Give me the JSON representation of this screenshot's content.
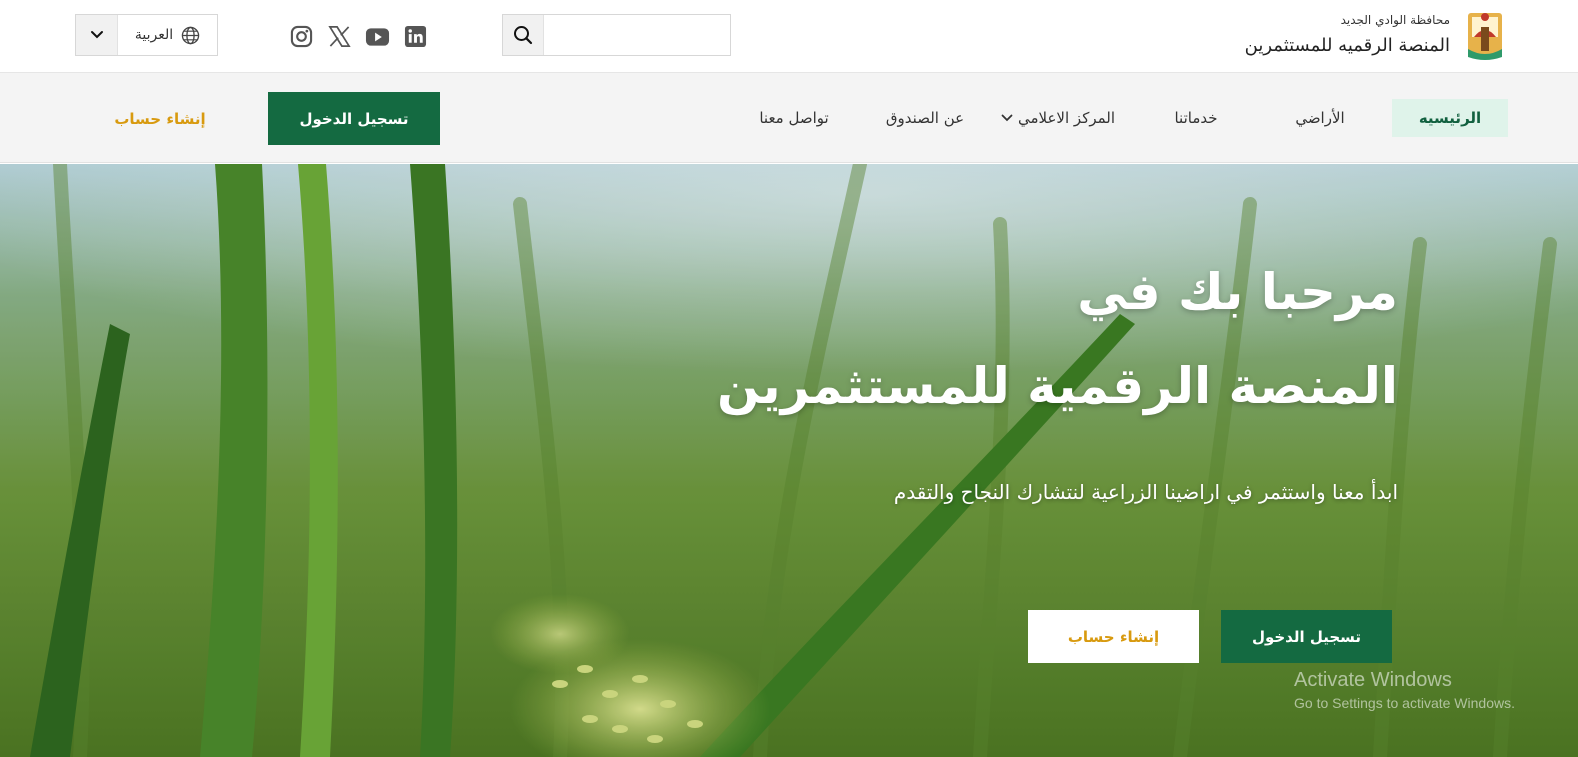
{
  "header": {
    "governorate": "محافظة الوادي الجديد",
    "platform_name": "المنصة الرقميه للمستثمرين",
    "search": {
      "placeholder": "",
      "value": ""
    },
    "social_icons": [
      "instagram-icon",
      "x-icon",
      "youtube-icon",
      "linkedin-icon"
    ],
    "language": {
      "label": "العربية",
      "icon": "globe-icon"
    }
  },
  "nav": {
    "items": [
      {
        "label": "الرئيسيه",
        "active": true
      },
      {
        "label": "الأراضي"
      },
      {
        "label": "خدماتنا"
      },
      {
        "label": "المركز الاعلامي",
        "has_dropdown": true
      },
      {
        "label": "عن الصندوق"
      },
      {
        "label": "تواصل معنا"
      }
    ],
    "login_label": "تسجيل الدخول",
    "register_label": "إنشاء حساب"
  },
  "hero": {
    "title_line1": "مرحبا بك في",
    "title_line2": "المنصة الرقمية للمستثمرين",
    "subtitle": "ابدأ معنا واستثمر في اراضينا الزراعية لنتشارك النجاح والتقدم",
    "login_label": "تسجيل الدخول",
    "register_label": "إنشاء حساب"
  },
  "watermark": {
    "line1": "Activate Windows",
    "line2": "Go to Settings to activate Windows."
  },
  "colors": {
    "primary_green": "#146a41",
    "accent_gold": "#d89a0f",
    "nav_bg": "#f4f4f4",
    "active_nav_bg": "#dff3ea"
  }
}
